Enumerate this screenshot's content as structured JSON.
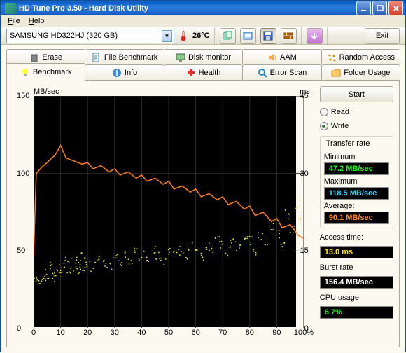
{
  "window": {
    "title": "HD Tune Pro 3.50 - Hard Disk Utility"
  },
  "menu": {
    "file": "File",
    "help": "Help"
  },
  "toolbar": {
    "drive": "SAMSUNG HD322HJ (320 GB)",
    "temp": "26°C",
    "exit": "Exit"
  },
  "tabs_row1": [
    {
      "label": "Erase",
      "icon": "trash"
    },
    {
      "label": "File Benchmark",
      "icon": "filebench"
    },
    {
      "label": "Disk monitor",
      "icon": "monitor"
    },
    {
      "label": "AAM",
      "icon": "speaker"
    },
    {
      "label": "Random Access",
      "icon": "random"
    }
  ],
  "tabs_row2": [
    {
      "label": "Benchmark",
      "icon": "bulb",
      "active": true
    },
    {
      "label": "Info",
      "icon": "info"
    },
    {
      "label": "Health",
      "icon": "health"
    },
    {
      "label": "Error Scan",
      "icon": "scan"
    },
    {
      "label": "Folder Usage",
      "icon": "folder"
    }
  ],
  "chart_data": {
    "type": "line+scatter",
    "title": "",
    "xlabel": "",
    "ylabel_left": "MB/sec",
    "ylabel_right": "ms",
    "xlim": [
      0,
      100
    ],
    "ylim_left": [
      0,
      150
    ],
    "ylim_right": [
      0,
      45
    ],
    "xticks": [
      0,
      10,
      20,
      30,
      40,
      50,
      60,
      70,
      80,
      90,
      100
    ],
    "yticks_left": [
      0,
      50,
      100,
      150
    ],
    "yticks_right": [
      0,
      15,
      30,
      45
    ],
    "series": [
      {
        "name": "Transfer rate (MB/sec)",
        "axis": "left",
        "type": "line",
        "color": "#ff8020",
        "x": [
          0,
          1,
          2,
          3,
          5,
          8,
          10,
          12,
          15,
          18,
          20,
          22,
          25,
          28,
          30,
          32,
          35,
          38,
          40,
          42,
          45,
          48,
          50,
          52,
          55,
          58,
          60,
          62,
          65,
          68,
          70,
          72,
          75,
          78,
          80,
          82,
          85,
          88,
          90,
          92,
          95,
          98,
          100
        ],
        "y": [
          47,
          100,
          102,
          104,
          107,
          112,
          118,
          110,
          108,
          106,
          107,
          103,
          105,
          101,
          103,
          99,
          101,
          97,
          99,
          95,
          97,
          93,
          95,
          90,
          92,
          88,
          90,
          85,
          87,
          83,
          85,
          80,
          82,
          77,
          79,
          73,
          75,
          69,
          71,
          65,
          67,
          60,
          58
        ]
      },
      {
        "name": "Access time (ms)",
        "axis": "right",
        "type": "scatter",
        "color": "#e8e040",
        "x": [
          1,
          2,
          3,
          4,
          5,
          6,
          7,
          8,
          9,
          10,
          11,
          12,
          13,
          14,
          15,
          16,
          17,
          18,
          19,
          20,
          22,
          24,
          26,
          28,
          30,
          32,
          34,
          36,
          38,
          40,
          42,
          44,
          46,
          48,
          50,
          52,
          54,
          56,
          58,
          60,
          62,
          64,
          66,
          68,
          70,
          72,
          74,
          76,
          78,
          80,
          82,
          84,
          86,
          88,
          90,
          92,
          94,
          96,
          98,
          99
        ],
        "y": [
          9,
          10,
          9,
          11,
          10,
          12,
          10,
          11,
          12,
          10,
          11,
          13,
          11,
          12,
          13,
          11,
          12,
          14,
          12,
          13,
          12,
          14,
          13,
          12,
          14,
          13,
          14,
          13,
          15,
          14,
          13,
          15,
          14,
          13,
          15,
          14,
          15,
          14,
          16,
          15,
          14,
          16,
          15,
          17,
          16,
          15,
          17,
          16,
          18,
          17,
          15,
          18,
          17,
          20,
          18,
          16,
          22,
          19,
          24,
          21
        ]
      }
    ]
  },
  "side": {
    "start": "Start",
    "read": "Read",
    "write": "Write",
    "mode": "write",
    "transfer_title": "Transfer rate",
    "min_label": "Minimum",
    "min_val": "47.2 MB/sec",
    "max_label": "Maximum",
    "max_val": "118.5 MB/sec",
    "avg_label": "Average:",
    "avg_val": "90.1 MB/sec",
    "access_label": "Access time:",
    "access_val": "13.0 ms",
    "burst_label": "Burst rate",
    "burst_val": "156.4 MB/sec",
    "cpu_label": "CPU usage",
    "cpu_val": "6.7%"
  }
}
